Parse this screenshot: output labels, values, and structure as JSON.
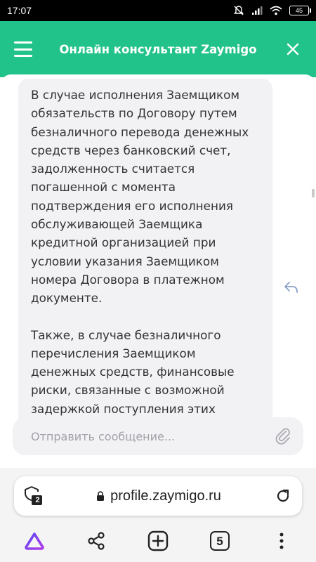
{
  "status_bar": {
    "time": "17:07",
    "battery": "45"
  },
  "header": {
    "title": "Онлайн консультант Zaymigo",
    "menu_icon": "hamburger-menu-icon",
    "close_icon": "close-icon"
  },
  "chat": {
    "message_paragraphs": [
      "В случае исполнения Заемщиком обязательств по Договору путем безналичного перевода денежных средств через банковский счет, задолженность считается погашенной с момента подтверждения его исполнения обслуживающей Заемщика кредитной организацией при условии указания Заемщиком номера Договора в платежном документе.",
      "Также, в случае безналичного перечисления Заемщиком денежных средств, финансовые риски, связанные с возможной задержкой поступления этих"
    ]
  },
  "composer": {
    "placeholder": "Отправить сообщение..."
  },
  "browser": {
    "url": "profile.zaymigo.ru",
    "shield_count": "2",
    "tab_count": "5"
  },
  "colors": {
    "accent": "#22c38a",
    "bubble": "#f2f2f5",
    "alice": "#7a3ff2"
  }
}
